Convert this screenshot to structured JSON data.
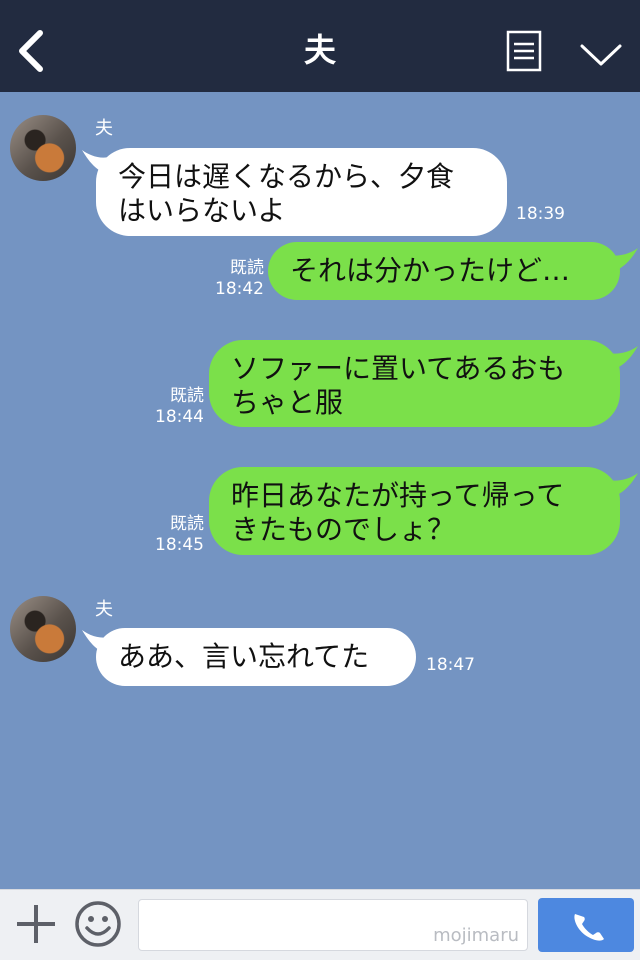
{
  "header": {
    "title": "夫",
    "background": "#222b40"
  },
  "colors": {
    "chat_background": "#7494c2",
    "incoming_bubble": "#ffffff",
    "outgoing_bubble": "#7be04a",
    "call_button": "#4d88e0"
  },
  "messages": [
    {
      "direction": "in",
      "sender": "夫",
      "lines": [
        "今日は遅くなるから、夕食",
        "はいらないよ"
      ],
      "time": "18:39"
    },
    {
      "direction": "out",
      "read": "既読",
      "lines": [
        "それは分かったけど…"
      ],
      "time": "18:42"
    },
    {
      "direction": "out",
      "read": "既読",
      "lines": [
        "ソファーに置いてあるおも",
        "ちゃと服"
      ],
      "time": "18:44"
    },
    {
      "direction": "out",
      "read": "既読",
      "lines": [
        "昨日あなたが持って帰って",
        "きたものでしょ？"
      ],
      "time": "18:45"
    },
    {
      "direction": "in",
      "sender": "夫",
      "lines": [
        "ああ、言い忘れてた"
      ],
      "time": "18:47"
    }
  ],
  "input_bar": {
    "watermark": "mojimaru",
    "icons": [
      "plus-icon",
      "smiley-icon",
      "phone-icon"
    ]
  }
}
